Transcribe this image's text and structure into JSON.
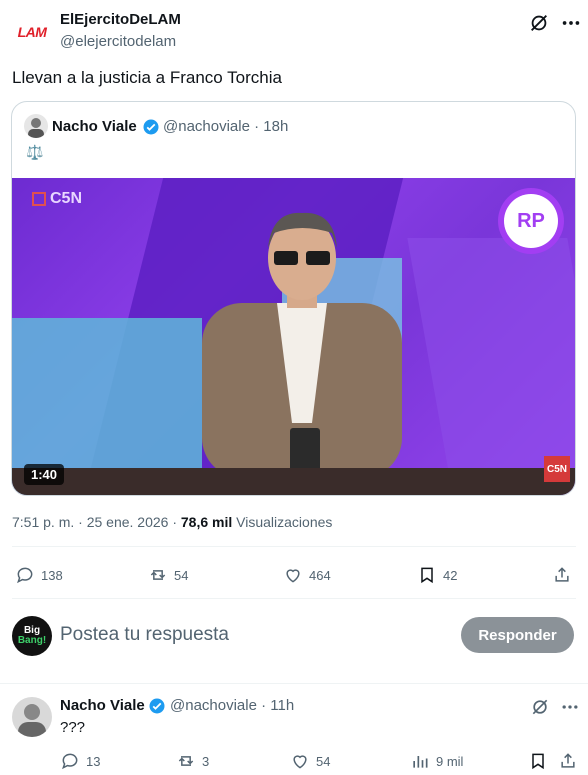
{
  "post": {
    "author_name": "ElEjercitoDeLAM",
    "author_handle": "@elejercitodelam",
    "avatar_text": "LAM",
    "text": "Llevan a la justicia a Franco Torchia",
    "timestamp": "7:51 p. m. · 25 ene. 2026 · ",
    "views_count": "78,6 mil",
    "views_label": " Visualizaciones",
    "actions": {
      "replies": "138",
      "reposts": "54",
      "likes": "464",
      "bookmarks": "42"
    }
  },
  "quote": {
    "author_name": "Nacho Viale",
    "author_handle_time": "@nachoviale · 18h",
    "emoji": "⚖️",
    "video": {
      "duration": "1:40",
      "channel_top": "C5N",
      "logo_text": "RP",
      "channel_bottom": "C5N"
    }
  },
  "reply_box": {
    "avatar_line1": "Big",
    "avatar_line2": "Bang!",
    "placeholder": "Postea tu respuesta",
    "button_label": "Responder"
  },
  "reply": {
    "author_name": "Nacho Viale",
    "author_handle_time": "@nachoviale · 11h",
    "text": "???",
    "actions": {
      "replies": "13",
      "reposts": "3",
      "likes": "54",
      "views": "9 mil"
    }
  },
  "colors": {
    "verified": "#1d9bf0",
    "muted": "#536471",
    "video_purple": "#7a36d9"
  }
}
